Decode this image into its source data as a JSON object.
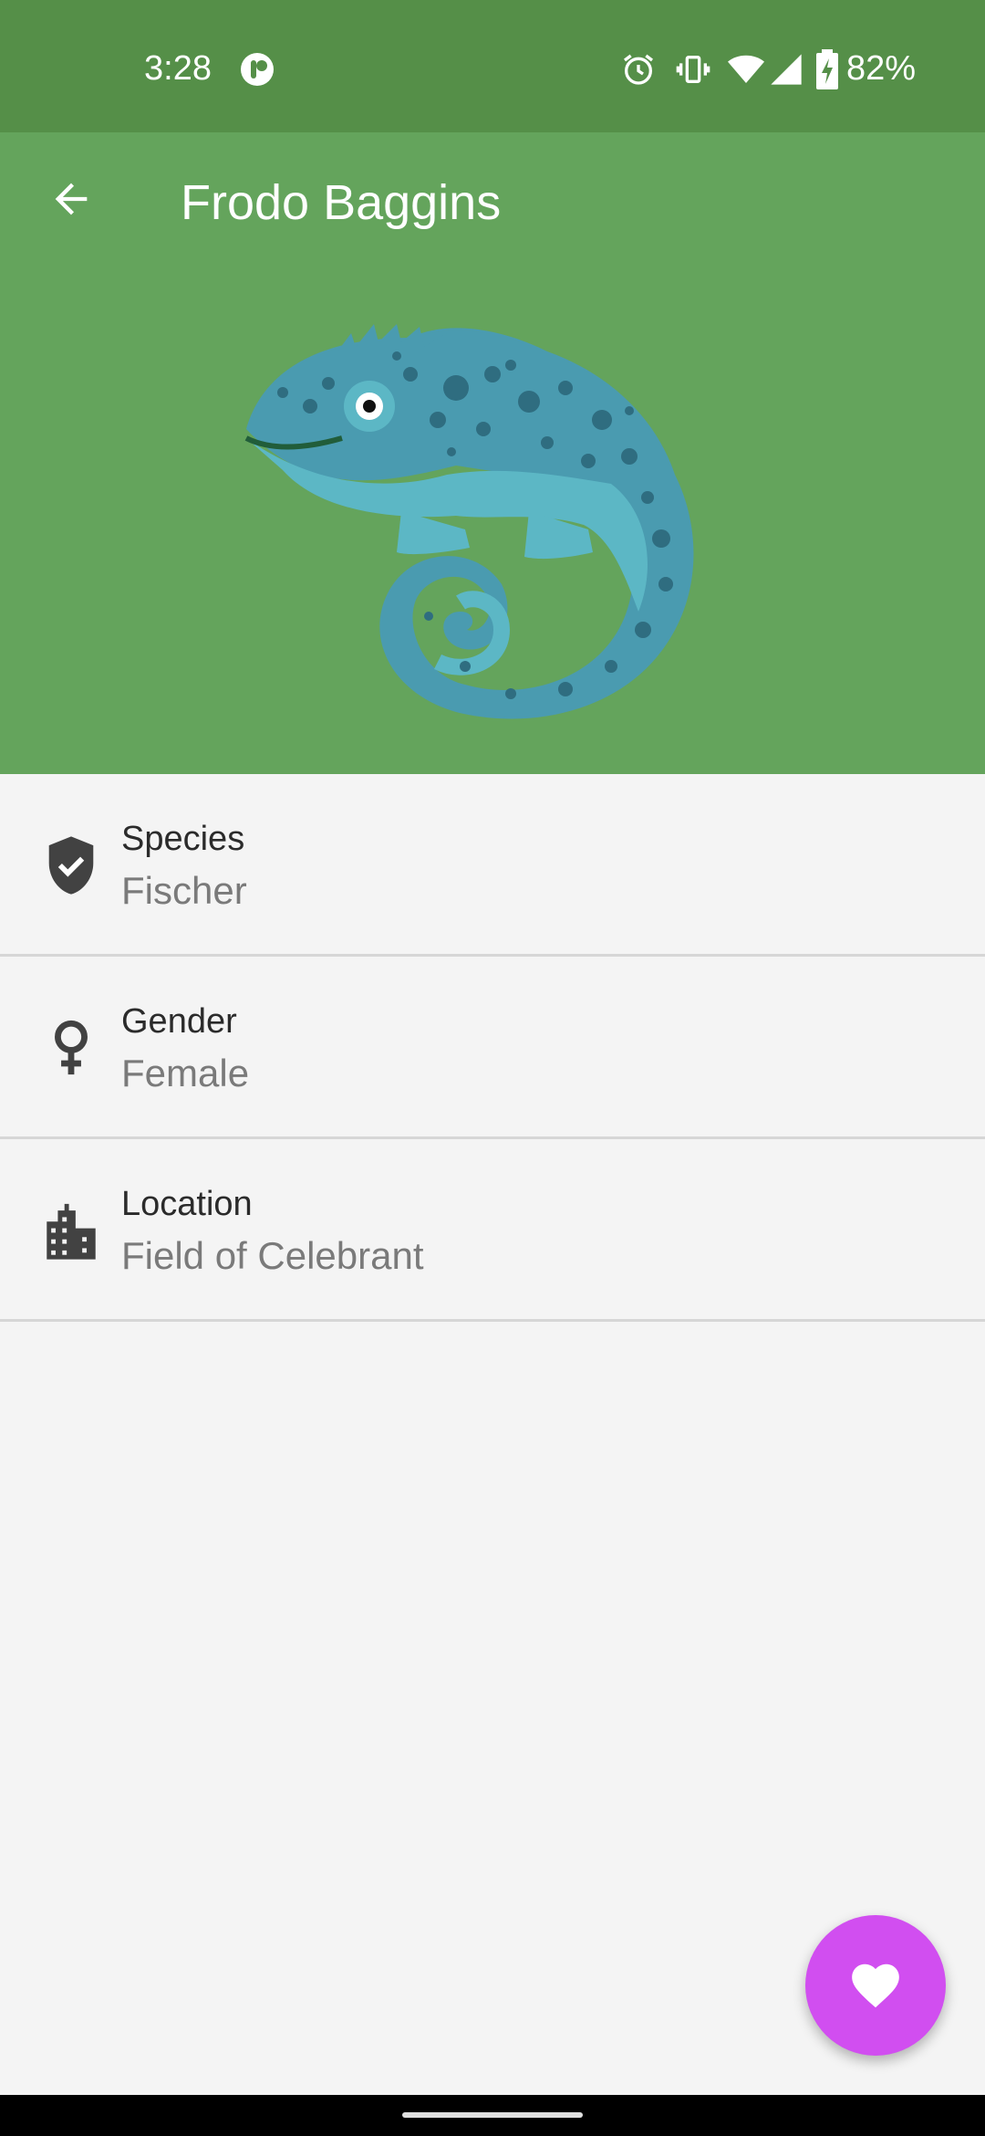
{
  "status_bar": {
    "time": "3:28",
    "battery_percent": "82%",
    "icons": [
      "app-notification-icon",
      "alarm-icon",
      "vibrate-icon",
      "wifi-icon",
      "cell-signal-icon",
      "battery-charging-icon"
    ]
  },
  "header": {
    "title": "Frodo Baggins",
    "back_icon": "arrow-back-icon",
    "background_color": "#64a45c",
    "hero_image": "chameleon-illustration"
  },
  "details": [
    {
      "icon": "verified-shield-icon",
      "label": "Species",
      "value": "Fischer"
    },
    {
      "icon": "female-icon",
      "label": "Gender",
      "value": "Female"
    },
    {
      "icon": "location-city-icon",
      "label": "Location",
      "value": "Field of Celebrant"
    }
  ],
  "fab": {
    "icon": "heart-icon",
    "color": "#d14ef0"
  },
  "colors": {
    "status_bar": "#558f48",
    "app_bar": "#64a45c",
    "background": "#f4f4f4"
  }
}
